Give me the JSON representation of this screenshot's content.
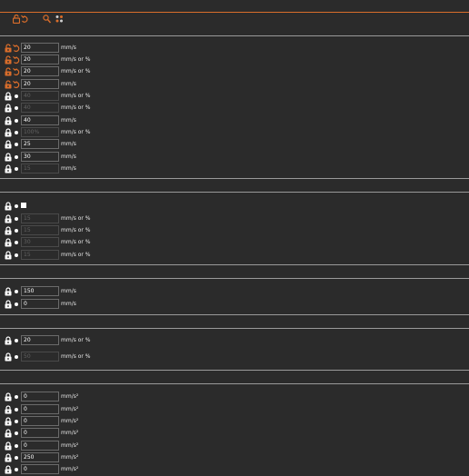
{
  "colors": {
    "accent": "#d96d2b",
    "background": "#2b2b2b",
    "text": "#e6e6e6",
    "divider": "#9a9a9a"
  },
  "toolbar": {
    "icons": [
      "unlock-icon",
      "undo-icon",
      "search-icon",
      "mode-toggle-icon"
    ]
  },
  "section1": {
    "rows": [
      {
        "value": "20",
        "unit": "mm/s",
        "enabled": true,
        "modified": true
      },
      {
        "value": "20",
        "unit": "mm/s or %",
        "enabled": true,
        "modified": true
      },
      {
        "value": "20",
        "unit": "mm/s or %",
        "enabled": true,
        "modified": true
      },
      {
        "value": "20",
        "unit": "mm/s",
        "enabled": true,
        "modified": true
      },
      {
        "value": "40",
        "unit": "mm/s or %",
        "enabled": false,
        "modified": false
      },
      {
        "value": "40",
        "unit": "mm/s or %",
        "enabled": false,
        "modified": false
      },
      {
        "value": "40",
        "unit": "mm/s",
        "enabled": true,
        "modified": false
      },
      {
        "value": "100%",
        "unit": "mm/s or %",
        "enabled": false,
        "modified": false
      },
      {
        "value": "25",
        "unit": "mm/s",
        "enabled": true,
        "modified": false
      },
      {
        "value": "30",
        "unit": "mm/s",
        "enabled": true,
        "modified": false
      },
      {
        "value": "15",
        "unit": "mm/s",
        "enabled": false,
        "modified": false
      }
    ]
  },
  "section2": {
    "checkbox_row": {
      "checked": true
    },
    "rows": [
      {
        "value": "15",
        "unit": "mm/s or %",
        "enabled": false
      },
      {
        "value": "15",
        "unit": "mm/s or %",
        "enabled": false
      },
      {
        "value": "30",
        "unit": "mm/s or %",
        "enabled": false
      },
      {
        "value": "15",
        "unit": "mm/s or %",
        "enabled": false
      }
    ]
  },
  "section3": {
    "rows": [
      {
        "value": "150",
        "unit": "mm/s",
        "enabled": true
      },
      {
        "value": "0",
        "unit": "mm/s",
        "enabled": true
      }
    ]
  },
  "section4": {
    "rows": [
      {
        "value": "20",
        "unit": "mm/s or %",
        "enabled": true
      },
      {
        "value": "50",
        "unit": "mm/s or %",
        "enabled": false
      }
    ]
  },
  "section5": {
    "rows": [
      {
        "value": "0",
        "unit": "mm/s²",
        "enabled": true
      },
      {
        "value": "0",
        "unit": "mm/s²",
        "enabled": true
      },
      {
        "value": "0",
        "unit": "mm/s²",
        "enabled": true
      },
      {
        "value": "0",
        "unit": "mm/s²",
        "enabled": true
      },
      {
        "value": "0",
        "unit": "mm/s²",
        "enabled": true
      },
      {
        "value": "250",
        "unit": "mm/s²",
        "enabled": true
      },
      {
        "value": "0",
        "unit": "mm/s²",
        "enabled": true
      }
    ]
  }
}
